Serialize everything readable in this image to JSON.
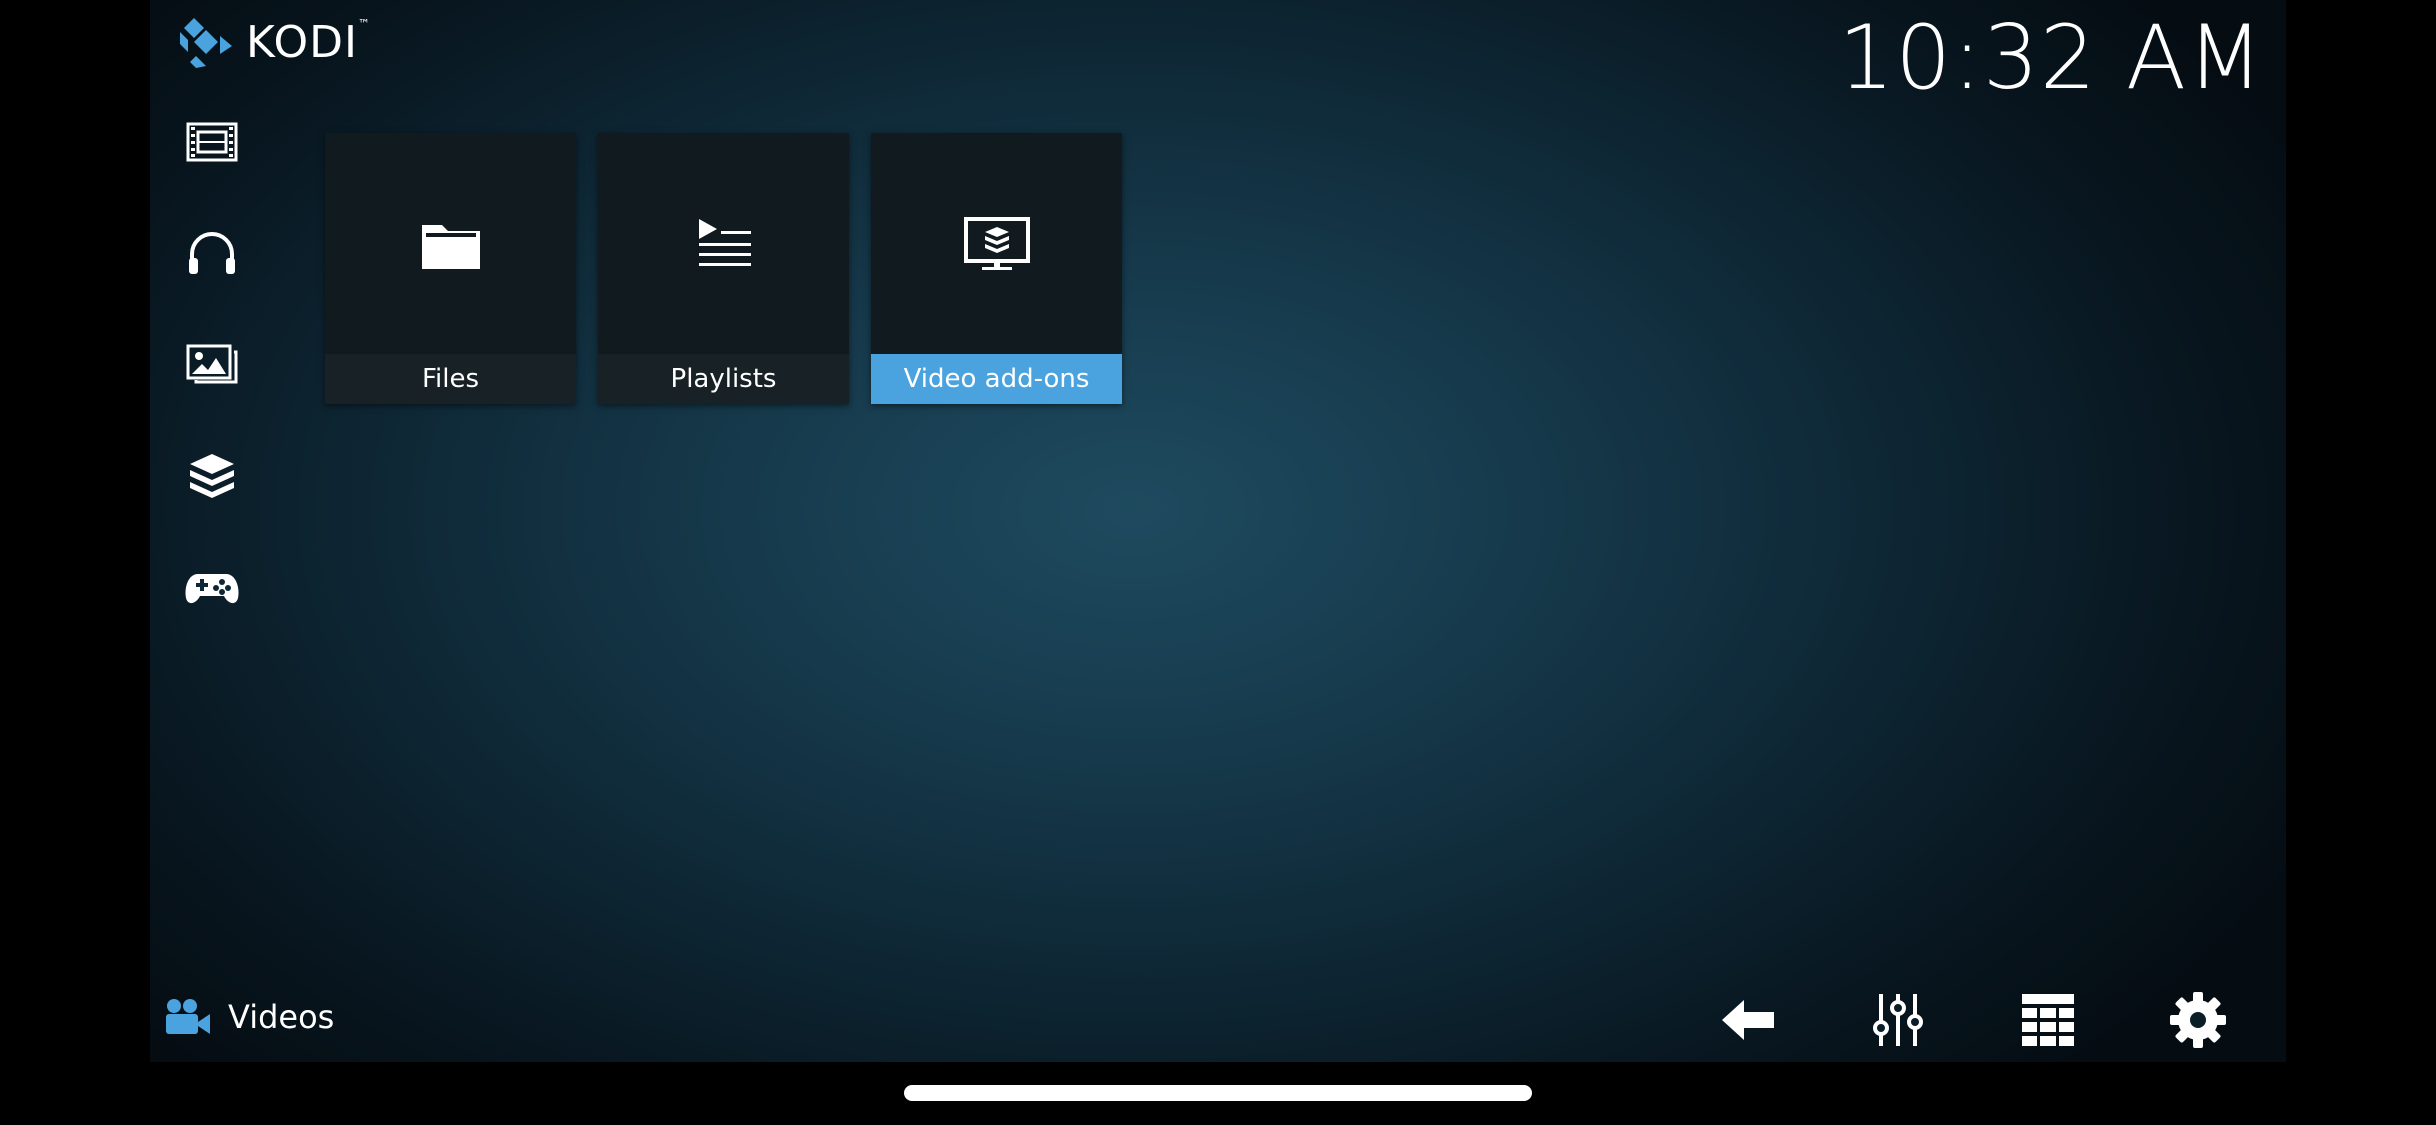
{
  "app": {
    "logo_text": "KODI",
    "trademark": "™"
  },
  "clock": {
    "time": "10:32 AM"
  },
  "sidebar": {
    "items": [
      {
        "name": "movies",
        "icon": "film-icon"
      },
      {
        "name": "music",
        "icon": "headphones-icon"
      },
      {
        "name": "pictures",
        "icon": "pictures-icon"
      },
      {
        "name": "addons",
        "icon": "addons-box-icon"
      },
      {
        "name": "games",
        "icon": "gamepad-icon"
      }
    ]
  },
  "tiles": [
    {
      "label": "Files",
      "icon": "folder-icon",
      "selected": false
    },
    {
      "label": "Playlists",
      "icon": "playlist-icon",
      "selected": false
    },
    {
      "label": "Video add-ons",
      "icon": "tv-addon-icon",
      "selected": true
    }
  ],
  "footer": {
    "section_label": "Videos",
    "section_icon": "video-camera-icon",
    "buttons": [
      {
        "name": "back",
        "icon": "back-arrow-icon"
      },
      {
        "name": "options",
        "icon": "sliders-icon"
      },
      {
        "name": "view",
        "icon": "grid-icon"
      },
      {
        "name": "settings",
        "icon": "gear-icon"
      }
    ]
  },
  "colors": {
    "accent": "#4aa3df",
    "tile_bg": "#111a1f",
    "icon_blue": "#4aa3df"
  }
}
